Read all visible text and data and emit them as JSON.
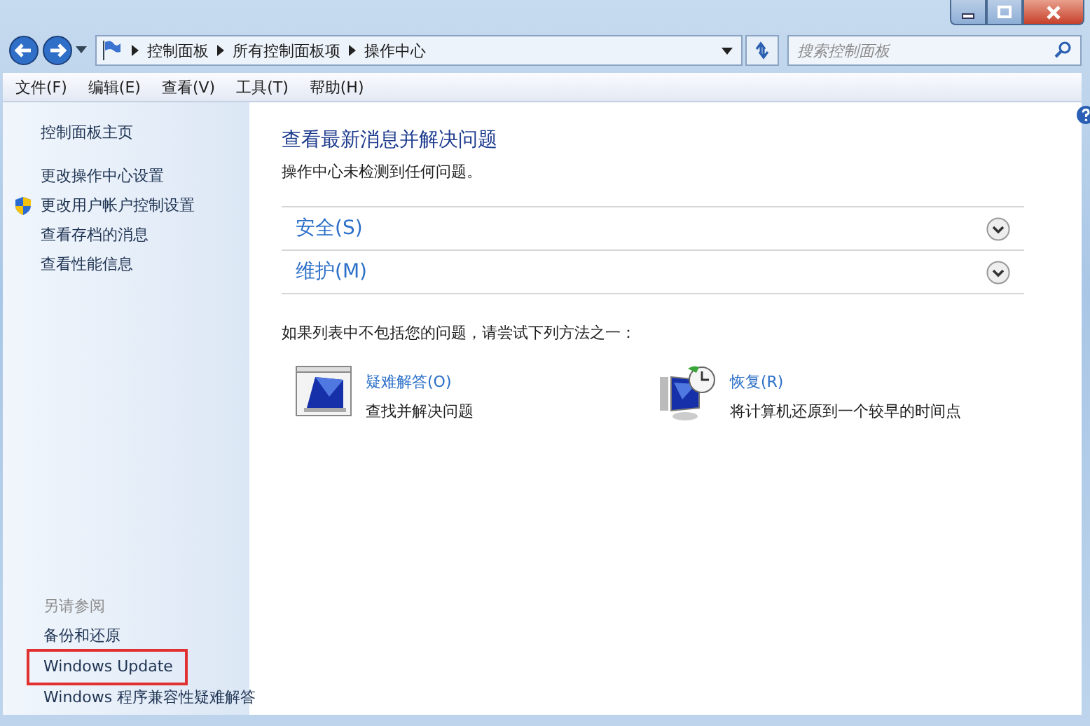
{
  "address_bar": {
    "breadcrumbs": [
      "控制面板",
      "所有控制面板项",
      "操作中心"
    ],
    "search": {
      "placeholder": "搜索控制面板"
    }
  },
  "menu_bar": [
    "文件(F)",
    "编辑(E)",
    "查看(V)",
    "工具(T)",
    "帮助(H)"
  ],
  "sidebar": {
    "items": [
      {
        "label": "控制面板主页",
        "kind": "plain"
      },
      {
        "label": "更改操作中心设置",
        "kind": "plain"
      },
      {
        "label": "更改用户帐户控制设置",
        "kind": "shield"
      },
      {
        "label": "查看存档的消息",
        "kind": "plain"
      },
      {
        "label": "查看性能信息",
        "kind": "plain"
      }
    ],
    "see_also": {
      "heading": "另请参阅",
      "items": [
        {
          "label": "备份和还原",
          "highlighted": false
        },
        {
          "label": "Windows Update",
          "highlighted": true
        },
        {
          "label": "Windows 程序兼容性疑难解答",
          "highlighted": false
        }
      ]
    }
  },
  "main": {
    "title": "查看最新消息并解决问题",
    "status": "操作中心未检测到任何问题。",
    "sections": [
      {
        "label": "安全(S)",
        "expanded": false
      },
      {
        "label": "维护(M)",
        "expanded": false
      }
    ],
    "hint": "如果列表中不包括您的问题，请尝试下列方法之一：",
    "options": [
      {
        "kind": "troubleshoot",
        "title": "疑难解答(O)",
        "description": "查找并解决问题"
      },
      {
        "kind": "recovery",
        "title": "恢复(R)",
        "description": "将计算机还原到一个较早的时间点"
      }
    ]
  }
}
